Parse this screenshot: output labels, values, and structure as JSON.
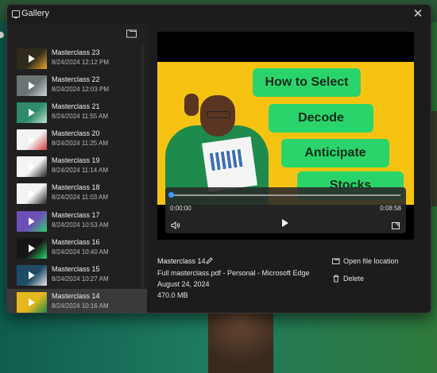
{
  "window": {
    "title": "Gallery"
  },
  "items": [
    {
      "name": "Masterclass 23",
      "date": "8/24/2024 12:12 PM",
      "bg": "#2f2a1c",
      "accent": "#e6a62b"
    },
    {
      "name": "Masterclass 22",
      "date": "8/24/2024 12:03 PM",
      "bg": "#6a7474",
      "accent": "#cfd6d6"
    },
    {
      "name": "Masterclass 21",
      "date": "8/24/2024 11:55 AM",
      "bg": "#2e8a6a",
      "accent": "#bde3cf"
    },
    {
      "name": "Masterclass 20",
      "date": "8/24/2024 11:25 AM",
      "bg": "#f2f2f2",
      "accent": "#d23a3a"
    },
    {
      "name": "Masterclass 19",
      "date": "8/24/2024 11:14 AM",
      "bg": "#f4f4f4",
      "accent": "#1d1d1d"
    },
    {
      "name": "Masterclass 18",
      "date": "8/24/2024 11:03 AM",
      "bg": "#f4f4f4",
      "accent": "#222222"
    },
    {
      "name": "Masterclass 17",
      "date": "8/24/2024 10:53 AM",
      "bg": "#6d4fb8",
      "accent": "#2bd46a"
    },
    {
      "name": "Masterclass 16",
      "date": "8/24/2024 10:40 AM",
      "bg": "#151515",
      "accent": "#2bd46a"
    },
    {
      "name": "Masterclass 15",
      "date": "8/24/2024 10:27 AM",
      "bg": "#1e4c66",
      "accent": "#e7e7e7"
    },
    {
      "name": "Masterclass 14",
      "date": "8/24/2024 10:16 AM",
      "bg": "#e4b81e",
      "accent": "#1e8a4c",
      "selected": true
    }
  ],
  "player": {
    "tags": [
      "How to Select",
      "Decode",
      "Anticipate",
      "Stocks"
    ],
    "time_current": "0:00:00",
    "time_total": "0:08:58",
    "progress": 0
  },
  "details": {
    "name": "Masterclass 14",
    "source": "Full masterclass.pdf - Personal - Microsoft Edge",
    "date": "August 24, 2024",
    "size": "470.0 MB"
  },
  "actions": {
    "open_location": "Open file location",
    "delete": "Delete"
  },
  "colors": {
    "accent_blue": "#3aa0ff",
    "tag_green": "#2bd46a",
    "frame_yellow": "#f6c312"
  }
}
